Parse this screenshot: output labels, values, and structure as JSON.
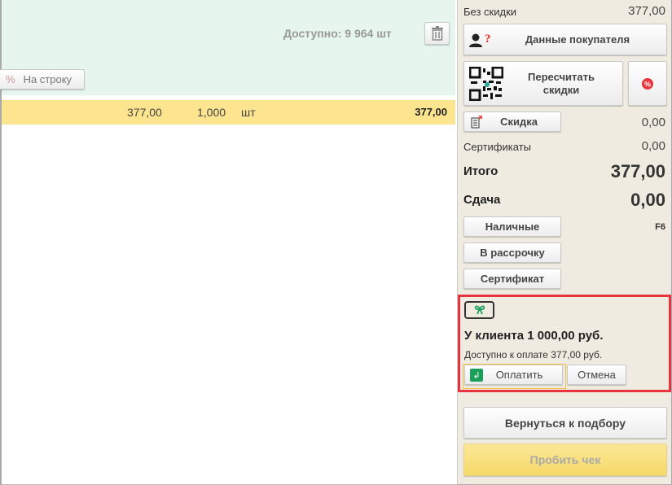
{
  "product": {
    "available": "Доступно: 9 964 шт",
    "per_line_label": "На строку",
    "per_line_icon": "%"
  },
  "row": {
    "price": "377,00",
    "quantity": "1,000",
    "unit": "шт",
    "sum": "377,00"
  },
  "summary": {
    "no_discount_label": "Без скидки",
    "no_discount_value": "377,00",
    "customer_button": "Данные покупателя",
    "recalc_button": "Пересчитать скидки",
    "discount_button": "Скидка",
    "discount_value": "0,00",
    "certificates_label": "Сертификаты",
    "certificates_value": "0,00",
    "total_label": "Итого",
    "total_value": "377,00",
    "change_label": "Сдача",
    "change_value": "0,00",
    "cash_button": "Наличные",
    "cash_hotkey": "F6",
    "installment_button": "В рассрочку",
    "certificate_button": "Сертификат"
  },
  "certificate_panel": {
    "client_balance": "У клиента 1 000,00 руб.",
    "available_to_pay": "Доступно к оплате 377,00 руб.",
    "pay_button": "Оплатить",
    "cancel_button": "Отмена"
  },
  "footer": {
    "back_button": "Вернуться к подбору",
    "print_button": "Пробить чек"
  },
  "colors": {
    "highlight": "#fde58f",
    "panel_bg": "#efebe0",
    "accent_red": "#e8343c",
    "green": "#1aa05a"
  }
}
